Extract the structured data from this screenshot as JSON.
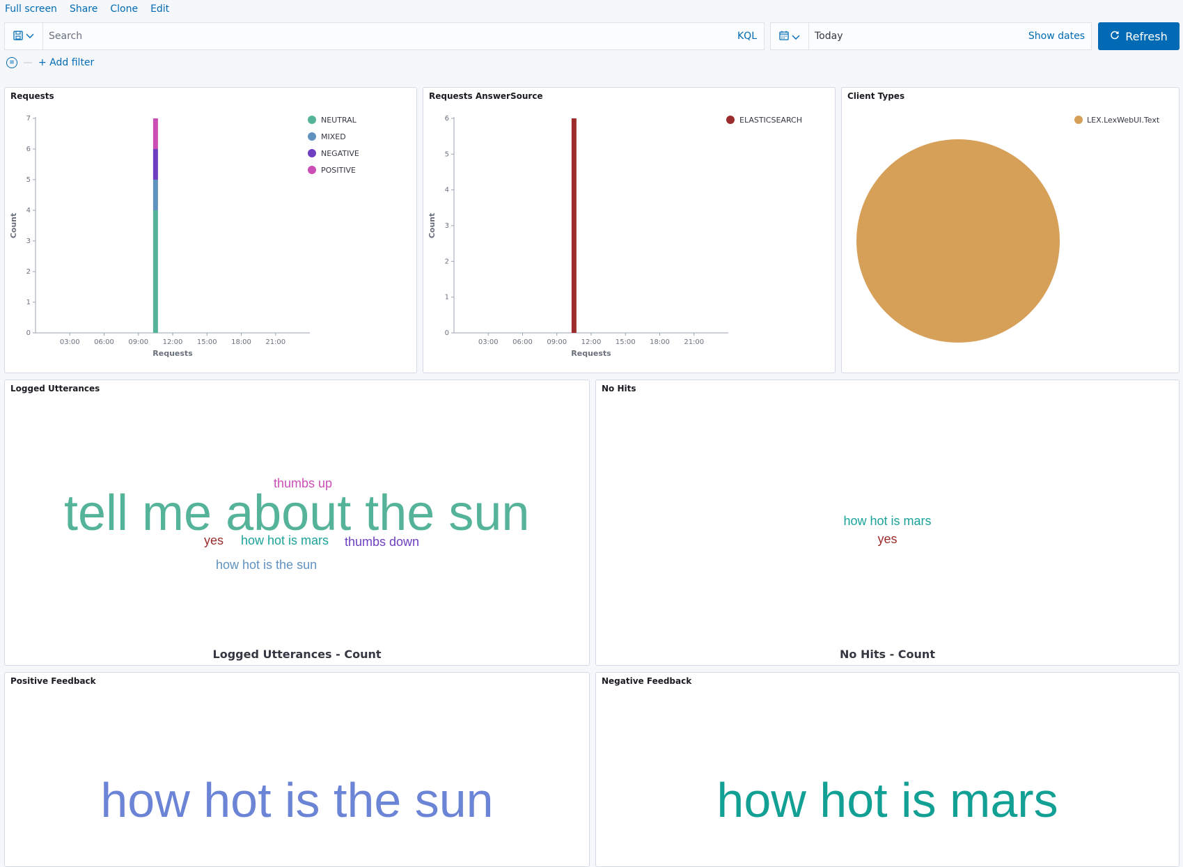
{
  "nav": {
    "full_screen": "Full screen",
    "share": "Share",
    "clone": "Clone",
    "edit": "Edit"
  },
  "search": {
    "placeholder": "Search",
    "kql": "KQL"
  },
  "date": {
    "value": "Today",
    "show_dates": "Show dates"
  },
  "refresh": {
    "label": "Refresh"
  },
  "filter": {
    "add": "+ Add filter"
  },
  "panels": {
    "requests": {
      "title": "Requests"
    },
    "answersource": {
      "title": "Requests AnswerSource"
    },
    "clienttypes": {
      "title": "Client Types"
    },
    "logged": {
      "title": "Logged Utterances",
      "caption": "Logged Utterances - Count"
    },
    "nohits": {
      "title": "No Hits",
      "caption": "No Hits - Count"
    },
    "positive": {
      "title": "Positive Feedback"
    },
    "negative": {
      "title": "Negative Feedback"
    }
  },
  "clouds": {
    "logged": [
      {
        "text": "tell me about the sun",
        "color": "#54b399"
      },
      {
        "text": "thumbs up",
        "color": "#ca4eb5"
      },
      {
        "text": "yes",
        "color": "#9c2c2c"
      },
      {
        "text": "how hot is mars",
        "color": "#1ba39a"
      },
      {
        "text": "thumbs down",
        "color": "#6e3fc1"
      },
      {
        "text": "how hot is the sun",
        "color": "#6092c0"
      }
    ],
    "nohits": [
      {
        "text": "how hot is mars",
        "color": "#1ba39a"
      },
      {
        "text": "yes",
        "color": "#9c2c2c"
      }
    ],
    "positive": [
      {
        "text": "how hot is the sun",
        "color": "#6b84d6"
      }
    ],
    "negative": [
      {
        "text": "how hot is mars",
        "color": "#12a095"
      }
    ]
  },
  "chart_data": [
    {
      "type": "bar",
      "title": "Requests",
      "xlabel": "Requests",
      "ylabel": "Count",
      "x_ticks": [
        "03:00",
        "06:00",
        "09:00",
        "12:00",
        "15:00",
        "18:00",
        "21:00"
      ],
      "ylim": [
        0,
        7
      ],
      "y_ticks": [
        0,
        1,
        2,
        3,
        4,
        5,
        6,
        7
      ],
      "categories": [
        "10:30"
      ],
      "series": [
        {
          "name": "NEUTRAL",
          "color": "#54b399",
          "values": [
            4
          ]
        },
        {
          "name": "MIXED",
          "color": "#6092c0",
          "values": [
            1
          ]
        },
        {
          "name": "NEGATIVE",
          "color": "#6e3fc1",
          "values": [
            1
          ]
        },
        {
          "name": "POSITIVE",
          "color": "#ca4eb5",
          "values": [
            1
          ]
        }
      ],
      "stacked": true,
      "legend": "top-right"
    },
    {
      "type": "bar",
      "title": "Requests AnswerSource",
      "xlabel": "Requests",
      "ylabel": "Count",
      "x_ticks": [
        "03:00",
        "06:00",
        "09:00",
        "12:00",
        "15:00",
        "18:00",
        "21:00"
      ],
      "ylim": [
        0,
        6
      ],
      "y_ticks": [
        0,
        1,
        2,
        3,
        4,
        5,
        6
      ],
      "categories": [
        "10:30"
      ],
      "series": [
        {
          "name": "ELASTICSEARCH",
          "color": "#9c2c2c",
          "values": [
            6
          ]
        }
      ],
      "legend": "top-right"
    },
    {
      "type": "pie",
      "title": "Client Types",
      "labels": [
        "LEX.LexWebUI.Text"
      ],
      "values": [
        7
      ],
      "colors": [
        "#d6a059"
      ],
      "legend": "top-right"
    }
  ]
}
